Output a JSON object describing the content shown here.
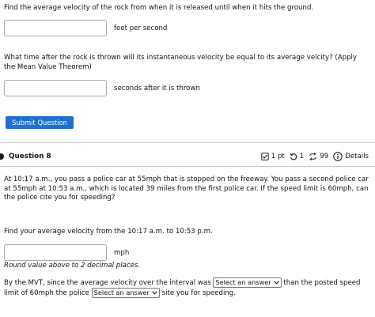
{
  "question7": {
    "part_a_prompt": "Find the average velocity of the rock from when it is released until when it hits the ground.",
    "part_a_value": "",
    "part_a_unit": "feet per second",
    "part_b_prompt": "What time after the rock is thrown will its instantaneous velocity be equal to its average velcity? (Apply the Mean Value Theorem)",
    "part_b_value": "",
    "part_b_unit": "seconds after it is thrown",
    "submit_label": "Submit Question"
  },
  "question8": {
    "title": "Question 8",
    "points": "1 pt",
    "retries": "1",
    "attempts": "99",
    "details_label": "Details",
    "scenario": "At 10:17 a.m., you pass a police car at 55mph that is stopped on the freeway. You pass a second police car at 55mph at 10:53 a.m., which is located 39 miles from the first police car. If the speed limit is 60mph, can the police cite you for speeding?",
    "velocity_prompt": "Find your average velocity from the 10:17 a.m. to 10:53 p.m.",
    "velocity_value": "",
    "velocity_unit": "mph",
    "rounding_note": "Round value above to 2 decimal places.",
    "mvt_text_1": "By the MVT, since the average velocity over the interval was",
    "select_1_value": "Select an answer",
    "mvt_text_2": "than the posted speed",
    "mvt_text_3": "limit of 60mph the police",
    "select_2_value": "Select an answer",
    "mvt_text_4": "site you for speeding."
  },
  "icons": {
    "points_icon": "checkbox-edit-icon",
    "retry_icon": "retry-icon",
    "attempts_icon": "attempts-cycle-icon",
    "details_icon": "info-circle-icon"
  },
  "colors": {
    "button_bg": "#1f6fcf",
    "button_text": "#ffffff"
  }
}
